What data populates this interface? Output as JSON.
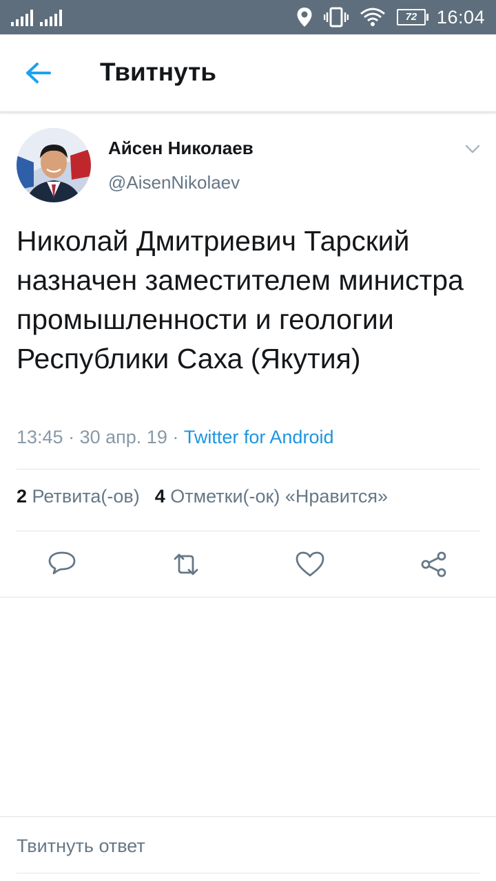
{
  "status_bar": {
    "time": "16:04",
    "battery": "72",
    "icons": [
      "signal-icon",
      "location-icon",
      "vibrate-icon",
      "wifi-icon",
      "battery-icon"
    ]
  },
  "header": {
    "title": "Твитнуть",
    "back_icon": "arrow-left-icon"
  },
  "tweet": {
    "author_name": "Айсен Николаев",
    "author_handle": "@AisenNikolaev",
    "text": "Николай Дмитриевич Тарский назначен заместителем министра промышленности и геологии Республики Саха (Якутия)",
    "time": "13:45",
    "date": "30 апр. 19",
    "separator": "·",
    "source": "Twitter for Android",
    "retweet_count": "2",
    "retweet_label": "Ретвита(-ов)",
    "like_count": "4",
    "like_label": "Отметки(-ок) «Нравится»"
  },
  "actions": [
    "reply-icon",
    "retweet-icon",
    "like-icon",
    "share-icon"
  ],
  "reply_placeholder": "Твитнуть ответ",
  "colors": {
    "status_bar": "#5e6e7c",
    "accent": "#1da1f2",
    "link": "#1b95e0",
    "secondary_text": "#657786",
    "divider": "#dfe3e7"
  }
}
